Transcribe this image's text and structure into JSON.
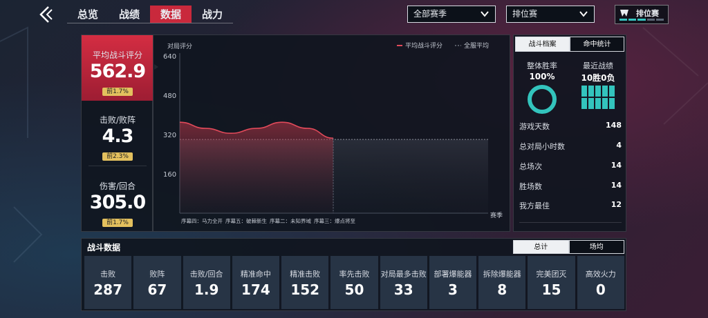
{
  "nav": {
    "tabs": [
      {
        "label": "总览",
        "active": false
      },
      {
        "label": "战绩",
        "active": false
      },
      {
        "label": "数据",
        "active": true
      },
      {
        "label": "战力",
        "active": false
      }
    ]
  },
  "filters": {
    "season": "全部赛季",
    "mode": "排位赛"
  },
  "mode_badge": {
    "label": "排位赛",
    "progress_segments_on": 3,
    "progress_segments_total": 5
  },
  "left_stats": [
    {
      "label": "平均战斗评分",
      "value": "562.9",
      "badge": "前1.7%"
    },
    {
      "label": "击败/败阵",
      "value": "4.3",
      "badge": "前2.3%"
    },
    {
      "label": "伤害/回合",
      "value": "305.0",
      "badge": "前1.7%"
    }
  ],
  "chart_data": {
    "type": "line",
    "ylabel": "对局评分",
    "xlabel": "赛季",
    "ylim": [
      0,
      640
    ],
    "yticks": [
      160,
      320,
      480,
      640
    ],
    "legend": [
      "平均战斗评分",
      "全服平均"
    ],
    "x": [
      "序幕四：马力全开",
      "序幕五：破棘新生",
      "序幕二：未知界域",
      "序幕三：爆点将至"
    ],
    "series": [
      {
        "name": "平均战斗评分",
        "color": "#e24a5a",
        "values": [
          370,
          345,
          325,
          345,
          370,
          345,
          305
        ]
      },
      {
        "name": "全服平均",
        "color": "#8a8f98",
        "values": [
          300
        ]
      }
    ]
  },
  "side": {
    "tabs": [
      {
        "label": "战斗档案",
        "active": true
      },
      {
        "label": "命中统计",
        "active": false
      }
    ],
    "winrate_label": "整体胜率",
    "winrate_value": "100%",
    "recent_label": "最近战绩",
    "recent_value": "10胜0负",
    "recent_wins": 10,
    "rows": [
      {
        "label": "游戏天数",
        "value": "148"
      },
      {
        "label": "总对局小时数",
        "value": "4"
      },
      {
        "label": "总场次",
        "value": "14"
      },
      {
        "label": "胜场数",
        "value": "14"
      },
      {
        "label": "我方最佳",
        "value": "12"
      }
    ]
  },
  "battle": {
    "title": "战斗数据",
    "tabs": [
      {
        "label": "总计",
        "active": true
      },
      {
        "label": "场均",
        "active": false
      }
    ],
    "cards": [
      {
        "label": "击败",
        "value": "287"
      },
      {
        "label": "败阵",
        "value": "67"
      },
      {
        "label": "击败/回合",
        "value": "1.9"
      },
      {
        "label": "精准命中",
        "value": "174"
      },
      {
        "label": "精准击败",
        "value": "152"
      },
      {
        "label": "率先击败",
        "value": "50"
      },
      {
        "label": "对局最多击败",
        "value": "33"
      },
      {
        "label": "部署爆能器",
        "value": "3"
      },
      {
        "label": "拆除爆能器",
        "value": "8"
      },
      {
        "label": "完美团灭",
        "value": "15"
      },
      {
        "label": "高效火力",
        "value": "0"
      }
    ]
  },
  "colors": {
    "accent": "#c9293c",
    "teal": "#33c4bd",
    "badge": "#e3c05e"
  }
}
